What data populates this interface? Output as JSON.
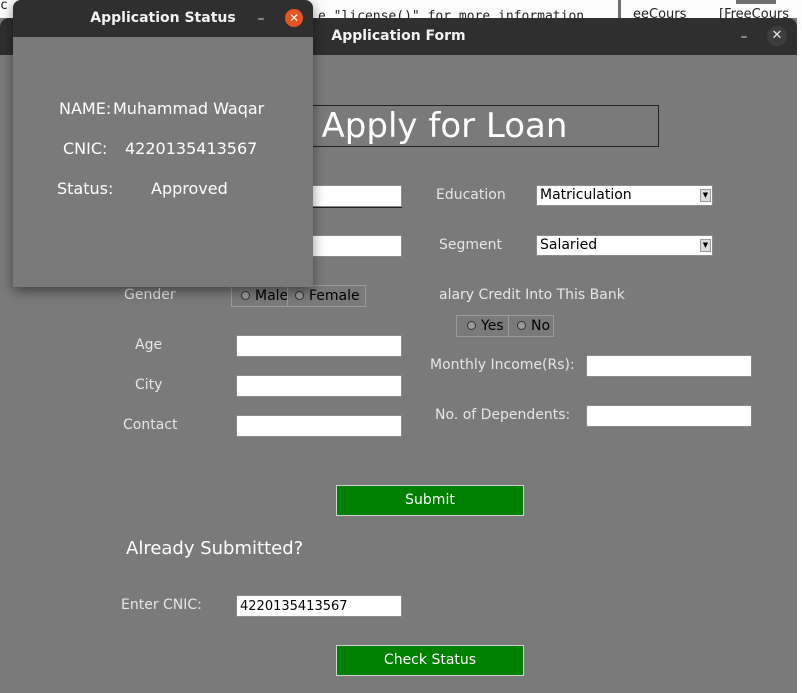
{
  "background": {
    "code_text": "e \"license()\" for more information.",
    "code_fragment": "c",
    "tab_1": "eeCours",
    "tab_2": "[FreeCours"
  },
  "main_window": {
    "title": "Application Form",
    "minimize": "–",
    "close": "✕",
    "heading": "Apply for Loan",
    "fields": {
      "education_label": "Education",
      "education_value": "Matriculation",
      "segment_label": "Segment",
      "segment_value": "Salaried",
      "gender_label": "Gender",
      "gender_options": [
        "Male",
        "Female"
      ],
      "salary_credit_label": "alary Credit Into This Bank",
      "salary_credit_options": [
        "Yes",
        "No"
      ],
      "age_label": "Age",
      "city_label": "City",
      "contact_label": "Contact",
      "monthly_income_label": "Monthly Income(Rs):",
      "dependents_label": "No. of Dependents:"
    },
    "submit_label": "Submit",
    "already_submitted": "Already Submitted?",
    "enter_cnic_label": "Enter CNIC:",
    "cnic_value": "4220135413567",
    "check_status_label": "Check Status"
  },
  "status_window": {
    "title": "Application Status",
    "minimize": "–",
    "close": "✕",
    "name_label": "NAME:",
    "name_value": "Muhammad Waqar",
    "cnic_label": "CNIC:",
    "cnic_value": "4220135413567",
    "status_label": "Status:",
    "status_value": "Approved"
  },
  "colors": {
    "window_bg": "#7a7a7a",
    "titlebar": "#2f2f2f",
    "button_green": "#008000",
    "close_orange": "#e95420"
  }
}
